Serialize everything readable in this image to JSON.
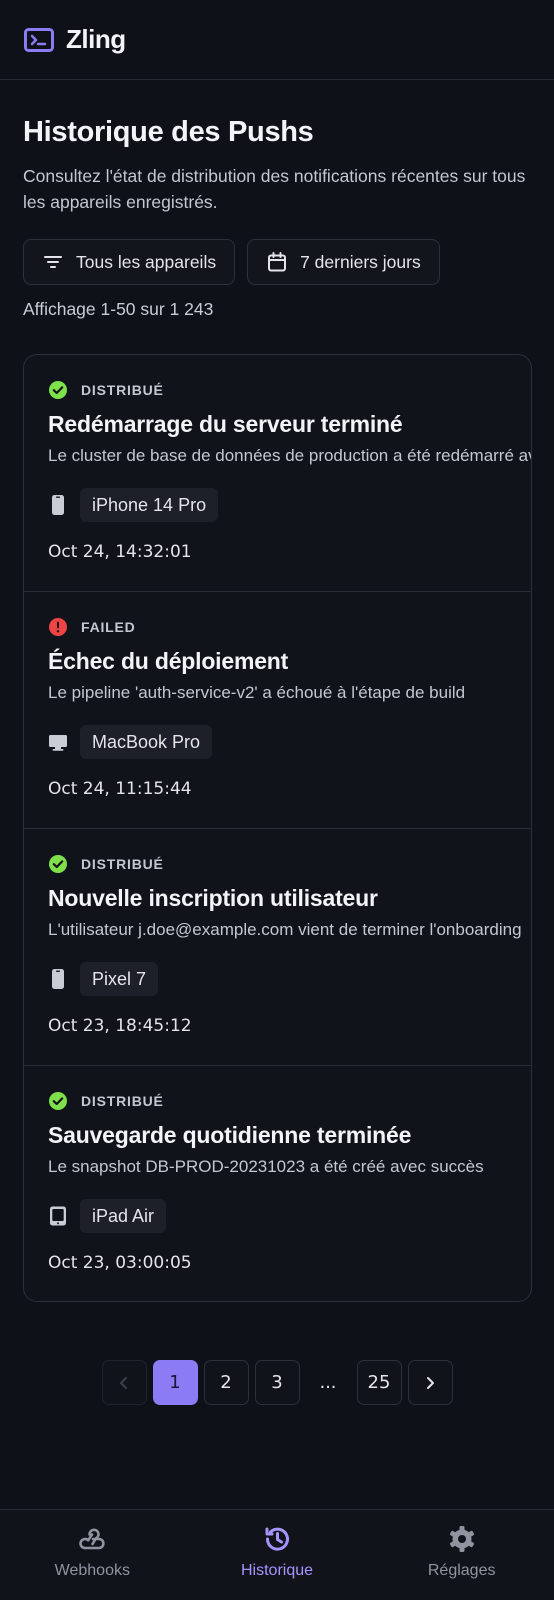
{
  "app": {
    "name": "Zling"
  },
  "page": {
    "title": "Historique des Pushs",
    "description": "Consultez l'état de distribution des notifications récentes sur tous les appareils enregistrés."
  },
  "filters": {
    "devices_label": "Tous les appareils",
    "range_label": "7 derniers jours"
  },
  "count_text": "Affichage 1-50 sur 1 243",
  "notifications": [
    {
      "status": "DISTRIBUÉ",
      "status_type": "success",
      "title": "Redémarrage du serveur terminé",
      "message": "Le cluster de base de données de production a été redémarré avec succès",
      "device": "iPhone 14 Pro",
      "device_icon": "phone-icon",
      "timestamp": "Oct 24, 14:32:01"
    },
    {
      "status": "FAILED",
      "status_type": "error",
      "title": "Échec du déploiement",
      "message": "Le pipeline 'auth-service-v2' a échoué à l'étape de build",
      "device": "MacBook Pro",
      "device_icon": "laptop-icon",
      "timestamp": "Oct 24, 11:15:44"
    },
    {
      "status": "DISTRIBUÉ",
      "status_type": "success",
      "title": "Nouvelle inscription utilisateur",
      "message": "L'utilisateur j.doe@example.com vient de terminer l'onboarding",
      "device": "Pixel 7",
      "device_icon": "phone-icon",
      "timestamp": "Oct 23, 18:45:12"
    },
    {
      "status": "DISTRIBUÉ",
      "status_type": "success",
      "title": "Sauvegarde quotidienne terminée",
      "message": "Le snapshot DB-PROD-20231023 a été créé avec succès",
      "device": "iPad Air",
      "device_icon": "tablet-icon",
      "timestamp": "Oct 23, 03:00:05"
    }
  ],
  "pagination": {
    "pages": [
      "1",
      "2",
      "3"
    ],
    "ellipsis": "...",
    "last": "25",
    "current": "1"
  },
  "nav": {
    "items": [
      {
        "label": "Webhooks",
        "icon": "webhook-icon",
        "active": false
      },
      {
        "label": "Historique",
        "icon": "history-icon",
        "active": true
      },
      {
        "label": "Réglages",
        "icon": "gear-icon",
        "active": false
      }
    ]
  },
  "colors": {
    "accent": "#8b7cf6",
    "success": "#7ee04a",
    "error": "#ef4444"
  }
}
